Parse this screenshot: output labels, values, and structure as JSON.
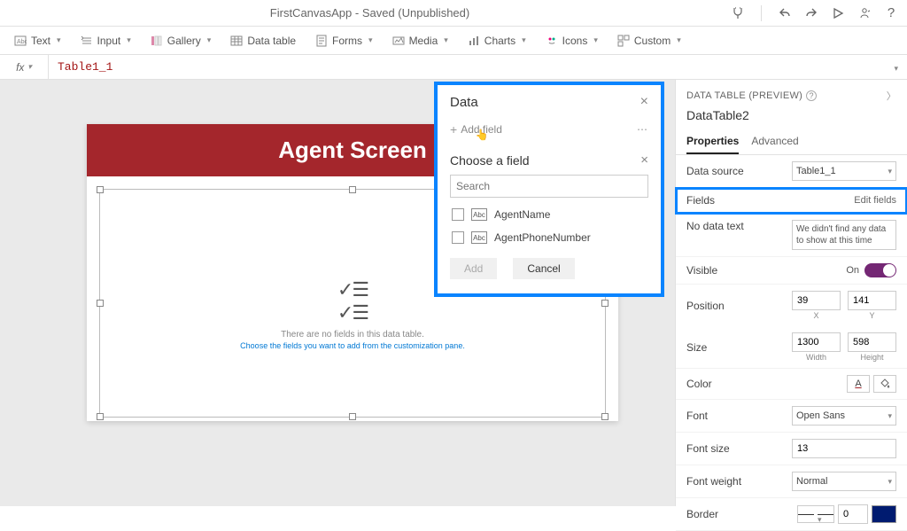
{
  "titlebar": {
    "title": "FirstCanvasApp - Saved (Unpublished)"
  },
  "ribbon": {
    "text": "Text",
    "input": "Input",
    "gallery": "Gallery",
    "datatable": "Data table",
    "forms": "Forms",
    "media": "Media",
    "charts": "Charts",
    "icons": "Icons",
    "custom": "Custom"
  },
  "fx": {
    "label": "fx",
    "value": "Table1_1"
  },
  "canvas": {
    "header": "Agent Screen",
    "empty_line1": "There are no fields in this data table.",
    "empty_line2": "Choose the fields you want to add from the customization pane."
  },
  "datapanel": {
    "title": "Data",
    "add_field": "Add field",
    "choose_title": "Choose a field",
    "search_placeholder": "Search",
    "fields": [
      {
        "name": "AgentName"
      },
      {
        "name": "AgentPhoneNumber"
      }
    ],
    "add_btn": "Add",
    "cancel_btn": "Cancel"
  },
  "props": {
    "section": "DATA TABLE (PREVIEW)",
    "name": "DataTable2",
    "tab_properties": "Properties",
    "tab_advanced": "Advanced",
    "datasource_label": "Data source",
    "datasource_value": "Table1_1",
    "fields_label": "Fields",
    "edit_fields": "Edit fields",
    "nodata_label": "No data text",
    "nodata_value": "We didn't find any data to show at this time",
    "visible_label": "Visible",
    "visible_on": "On",
    "position_label": "Position",
    "pos_x": "39",
    "pos_y": "141",
    "pos_xlabel": "X",
    "pos_ylabel": "Y",
    "size_label": "Size",
    "size_w": "1300",
    "size_h": "598",
    "size_wlabel": "Width",
    "size_hlabel": "Height",
    "color_label": "Color",
    "font_label": "Font",
    "font_value": "Open Sans",
    "fontsize_label": "Font size",
    "fontsize_value": "13",
    "fontweight_label": "Font weight",
    "fontweight_value": "Normal",
    "border_label": "Border",
    "border_width": "0"
  }
}
